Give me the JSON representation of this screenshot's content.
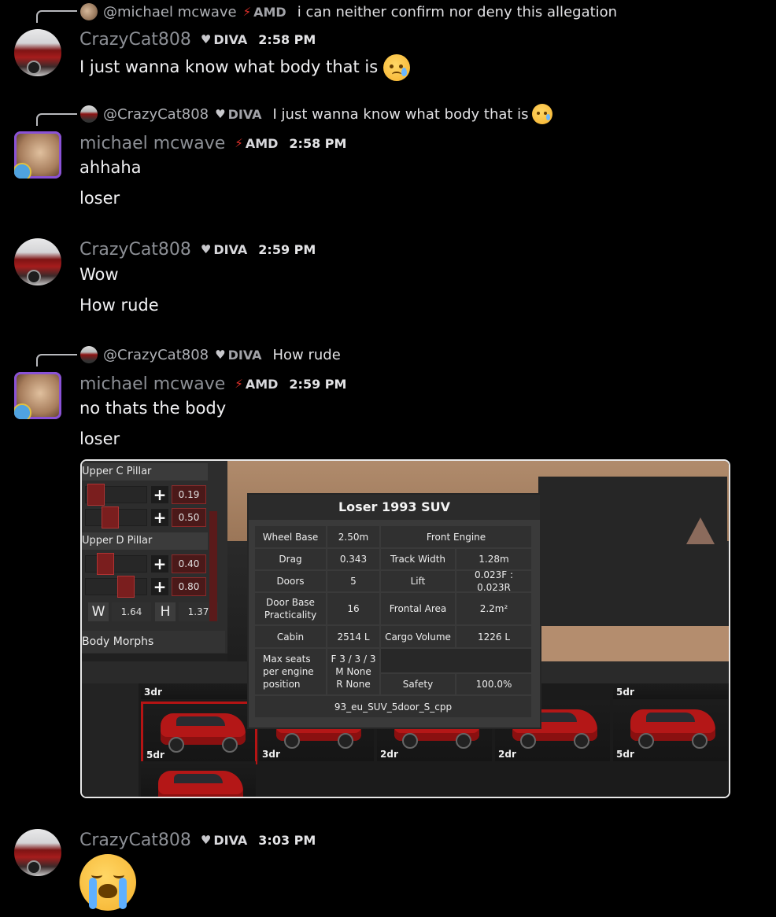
{
  "messages": [
    {
      "reply": {
        "name": "@michael mcwave",
        "tag": "AMD",
        "text": "i can neither confirm nor deny this allegation"
      },
      "author": "CrazyCat808",
      "tag": "DIVA",
      "time": "2:58 PM",
      "lines": [
        "I just wanna know what body that is"
      ]
    },
    {
      "reply": {
        "name": "@CrazyCat808",
        "tag": "DIVA",
        "text": "I just wanna know what body that is"
      },
      "author": "michael mcwave",
      "tag": "AMD",
      "time": "2:58 PM",
      "lines": [
        "ahhaha",
        "loser"
      ]
    },
    {
      "author": "CrazyCat808",
      "tag": "DIVA",
      "time": "2:59 PM",
      "lines": [
        "Wow",
        "How rude"
      ]
    },
    {
      "reply": {
        "name": "@CrazyCat808",
        "tag": "DIVA",
        "text": "How rude"
      },
      "author": "michael mcwave",
      "tag": "AMD",
      "time": "2:59 PM",
      "lines": [
        "no thats the body",
        "loser"
      ]
    },
    {
      "author": "CrazyCat808",
      "tag": "DIVA",
      "time": "3:03 PM",
      "lines": []
    }
  ],
  "icons": {
    "diva_tag": "heart-icon",
    "amd_tag": "lightning-bolt-icon",
    "sad_emoji": "sad-but-relieved-face-emoji",
    "cry_emoji": "loudly-crying-face-emoji"
  },
  "attachment": {
    "left_panel": {
      "sections": [
        "Upper C Pillar",
        "Upper D Pillar"
      ],
      "values": [
        "0.19",
        "0.50",
        "0.40",
        "0.80"
      ],
      "w_label": "W",
      "w_value": "1.64",
      "h_label": "H",
      "h_value": "1.37",
      "morphs_label": "Body Morphs"
    },
    "stats": {
      "title": "Loser 1993 SUV",
      "wheel_base_label": "Wheel Base",
      "wheel_base": "2.50m",
      "engine": "Front Engine",
      "drag_label": "Drag",
      "drag": "0.343",
      "track_label": "Track Width",
      "track": "1.28m",
      "doors_label": "Doors",
      "doors": "5",
      "lift_label": "Lift",
      "lift": "0.023F : 0.023R",
      "door_base_label": "Door Base\nPracticality",
      "door_base": "16",
      "frontal_label": "Frontal Area",
      "frontal": "2.2m²",
      "cabin_label": "Cabin",
      "cabin": "2514 L",
      "cargo_label": "Cargo Volume",
      "cargo": "1226 L",
      "seats_label": "Max seats\nper engine\nposition",
      "seats": "F 3 / 3 / 3\nM None\nR None",
      "safety_label": "Safety",
      "safety": "100.0%",
      "body_file": "93_eu_SUV_5door_S_cpp"
    },
    "thumbnails": [
      "3dr",
      "5dr",
      "5dr",
      "3dr",
      "2dr",
      "2dr",
      "5dr"
    ]
  }
}
